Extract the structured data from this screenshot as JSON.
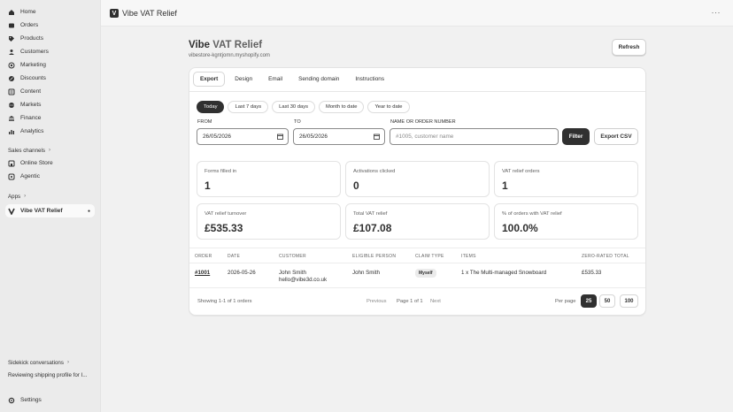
{
  "app": {
    "title": "Vibe VAT Relief",
    "logo_letter": "V",
    "more": "···"
  },
  "sidebar": {
    "items": [
      {
        "label": "Home",
        "icon": "home-icon"
      },
      {
        "label": "Orders",
        "icon": "orders-icon"
      },
      {
        "label": "Products",
        "icon": "tag-icon"
      },
      {
        "label": "Customers",
        "icon": "person-icon"
      },
      {
        "label": "Marketing",
        "icon": "target-icon"
      },
      {
        "label": "Discounts",
        "icon": "discount-icon"
      },
      {
        "label": "Content",
        "icon": "content-icon"
      },
      {
        "label": "Markets",
        "icon": "globe-icon"
      },
      {
        "label": "Finance",
        "icon": "bank-icon"
      },
      {
        "label": "Analytics",
        "icon": "chart-icon"
      }
    ],
    "sales_channels_label": "Sales channels",
    "channels": [
      {
        "label": "Online Store",
        "icon": "store-icon"
      },
      {
        "label": "Agentic",
        "icon": "agentic-icon"
      }
    ],
    "apps_label": "Apps",
    "apps": [
      {
        "label": "Vibe VAT Relief",
        "icon": "vibe-app-icon"
      }
    ],
    "sidekick_label": "Sidekick conversations",
    "sidekick_item": "Reviewing shipping profile for I...",
    "settings_label": "Settings"
  },
  "page": {
    "title_strong": "Vibe",
    "title_rest": " VAT Relief",
    "subtitle": "vibestore-kgntjomn.myshopify.com",
    "refresh_label": "Refresh"
  },
  "tabs": [
    "Export",
    "Design",
    "Email",
    "Sending domain",
    "Instructions"
  ],
  "date_chips": [
    "Today",
    "Last 7 days",
    "Last 30 days",
    "Month to date",
    "Year to date"
  ],
  "filters": {
    "from_label": "FROM",
    "from_value": "26/05/2026",
    "to_label": "TO",
    "to_value": "26/05/2026",
    "search_label": "NAME OR ORDER NUMBER",
    "search_placeholder": "#1005, customer name",
    "filter_button": "Filter",
    "export_button": "Export CSV"
  },
  "stats": [
    {
      "label": "Forms filled in",
      "value": "1"
    },
    {
      "label": "Activations clicked",
      "value": "0"
    },
    {
      "label": "VAT relief orders",
      "value": "1"
    },
    {
      "label": "VAT relief turnover",
      "value": "£535.33"
    },
    {
      "label": "Total VAT relief",
      "value": "£107.08"
    },
    {
      "label": "% of orders with VAT relief",
      "value": "100.0%"
    }
  ],
  "table": {
    "headers": [
      "ORDER",
      "DATE",
      "CUSTOMER",
      "ELIGIBLE PERSON",
      "CLAIM TYPE",
      "ITEMS",
      "ZERO-RATED TOTAL"
    ],
    "row": {
      "order": "#1001",
      "date": "2026-05-26",
      "customer_name": "John Smith",
      "customer_email": "hello@vibe3d.co.uk",
      "eligible_person": "John Smith",
      "claim_type": "Myself",
      "items": "1 x The Multi-managed Snowboard",
      "total": "£535.33"
    }
  },
  "pagination": {
    "showing": "Showing 1-1 of 1 orders",
    "previous": "Previous",
    "page_of": "Page 1 of 1",
    "next": "Next",
    "per_page_label": "Per page",
    "options": [
      "25",
      "50",
      "100"
    ],
    "selected": "25"
  }
}
